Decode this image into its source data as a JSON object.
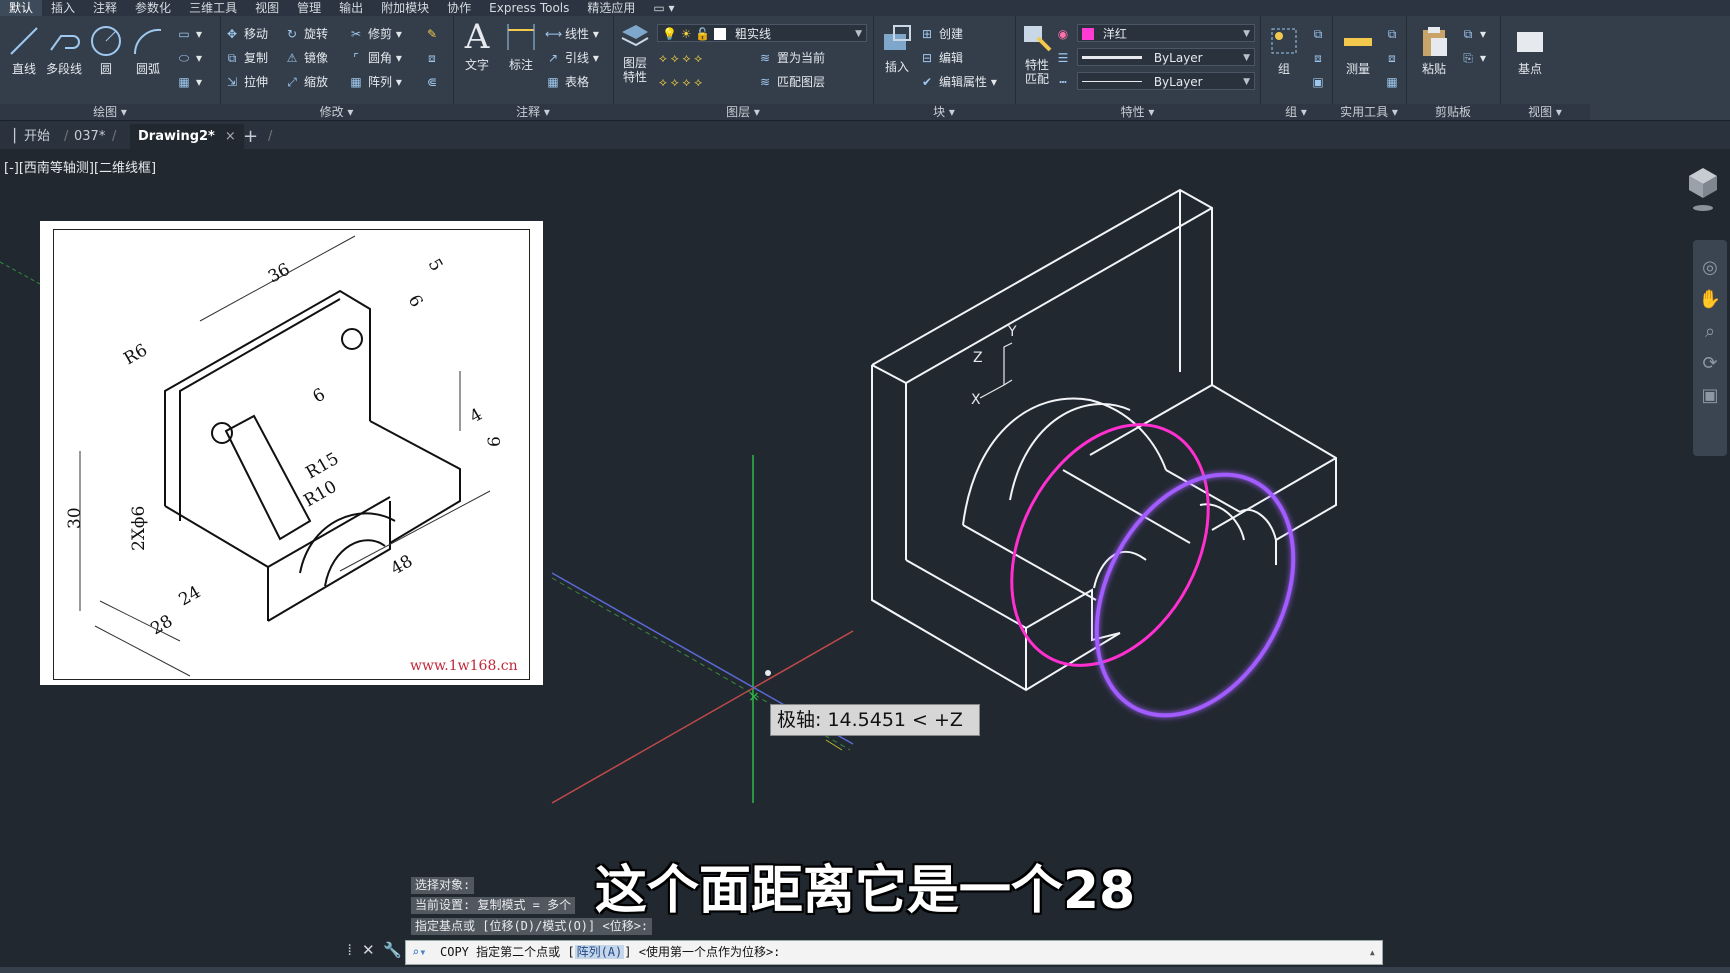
{
  "menu": [
    "默认",
    "插入",
    "注释",
    "参数化",
    "三维工具",
    "视图",
    "管理",
    "输出",
    "附加模块",
    "协作",
    "Express Tools",
    "精选应用",
    "▭ ▾"
  ],
  "ribbon": {
    "draw": {
      "title": "绘图 ▾",
      "line": "直线",
      "polyline": "多段线",
      "circle": "圆",
      "arc": "圆弧"
    },
    "modify": {
      "title": "修改 ▾",
      "move": "移动",
      "rotate": "旋转",
      "trim": "修剪",
      "copy": "复制",
      "mirror": "镜像",
      "fillet": "圆角",
      "stretch": "拉伸",
      "scale": "缩放",
      "array": "阵列"
    },
    "annotation": {
      "title": "注释 ▾",
      "text": "文字",
      "dimension": "标注",
      "linear": "线性",
      "leader": "引线",
      "table": "表格"
    },
    "layers": {
      "title": "图层 ▾",
      "layer_props_1": "图层",
      "layer_props_2": "特性",
      "current_layer": "粗实线",
      "make_current": "置为当前",
      "match_layer": "匹配图层"
    },
    "block": {
      "title": "块 ▾",
      "insert": "插入",
      "create": "创建",
      "edit": "编辑",
      "edit_attr": "编辑属性"
    },
    "properties": {
      "title": "特性 ▾",
      "match_1": "特性",
      "match_2": "匹配",
      "color": "洋红",
      "color_hex": "#ff3bd4",
      "linetype": "ByLayer",
      "lineweight": "ByLayer"
    },
    "groups": {
      "title": "组 ▾",
      "group": "组"
    },
    "utilities": {
      "title": "实用工具 ▾",
      "measure": "测量"
    },
    "clipboard": {
      "title": "剪贴板",
      "paste": "粘贴"
    },
    "view": {
      "title": "视图 ▾",
      "base": "基点"
    }
  },
  "tabs": {
    "start": "开始",
    "file1": "037*",
    "active": "Drawing2*",
    "close": "×",
    "add": "+"
  },
  "viewport_label": "[-][西南等轴测][二维线框]",
  "reference": {
    "dims": [
      "36",
      "5",
      "R6",
      "6",
      "6",
      "4",
      "6",
      "30",
      "2Xϕ6",
      "R15",
      "R10",
      "24",
      "28",
      "48"
    ],
    "watermark": "www.1w168.cn"
  },
  "ucs": {
    "x": "X",
    "y": "Y",
    "z": "Z"
  },
  "tooltip": "极轴: 14.5451 < +Z",
  "subtitle": "这个面距离它是一个28",
  "command_history": [
    "选择对象:",
    "当前设置:  复制模式 = 多个",
    "指定基点或 [位移(D)/模式(O)] <位移>:"
  ],
  "command_line": {
    "prefix": "COPY 指定第二个点或 [",
    "option": "阵列(A)",
    "suffix": "] <使用第一个点作为位移>:"
  },
  "colors": {
    "magenta": "#ff2fd0",
    "violet": "#a35cff",
    "background": "#212830"
  }
}
